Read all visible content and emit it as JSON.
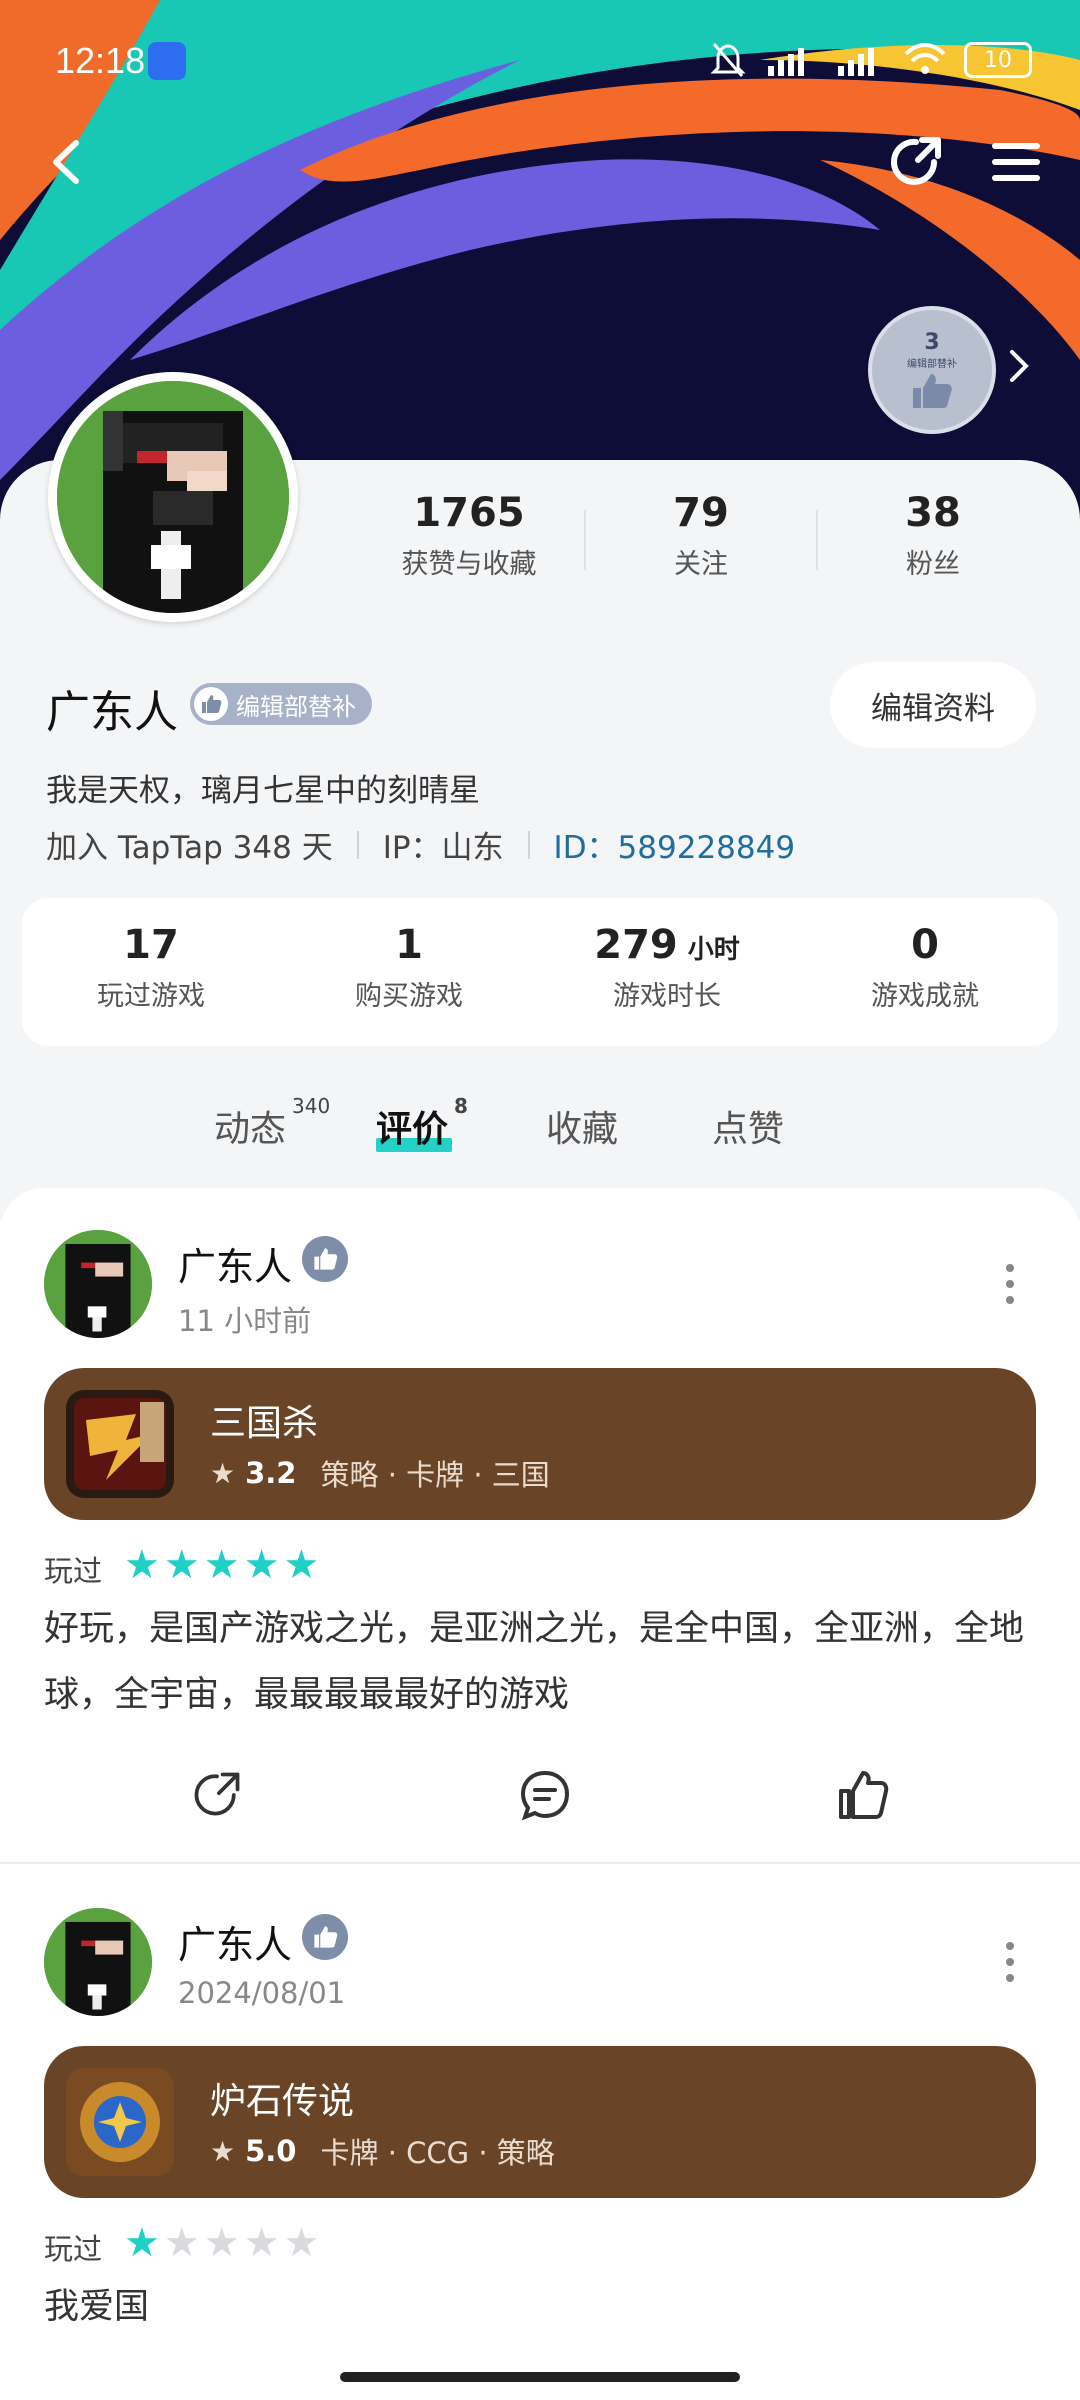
{
  "status_bar": {
    "time": "12:18",
    "battery": "10"
  },
  "header": {
    "badge_level": "3",
    "badge_caption": "编辑部替补"
  },
  "profile": {
    "stats": [
      {
        "value": "1765",
        "label": "获赞与收藏"
      },
      {
        "value": "79",
        "label": "关注"
      },
      {
        "value": "38",
        "label": "粉丝"
      }
    ],
    "username": "广东人",
    "badge": "编辑部替补",
    "edit_button": "编辑资料",
    "bio": "我是天权，璃月七星中的刻晴星",
    "joined": "加入 TapTap 348 天",
    "ip": "IP：山东",
    "id": "ID：589228849"
  },
  "game_stats": [
    {
      "value": "17",
      "unit": "",
      "label": "玩过游戏"
    },
    {
      "value": "1",
      "unit": "",
      "label": "购买游戏"
    },
    {
      "value": "279",
      "unit": "小时",
      "label": "游戏时长"
    },
    {
      "value": "0",
      "unit": "",
      "label": "游戏成就"
    }
  ],
  "tabs": [
    {
      "label": "动态",
      "count": "340"
    },
    {
      "label": "评价",
      "count": "8"
    },
    {
      "label": "收藏",
      "count": ""
    },
    {
      "label": "点赞",
      "count": ""
    }
  ],
  "posts": [
    {
      "author": "广东人",
      "time": "11 小时前",
      "game": {
        "title": "三国杀",
        "rating": "3.2",
        "tags": "策略 · 卡牌 · 三国"
      },
      "played_label": "玩过",
      "stars": 5,
      "text": "好玩，是国产游戏之光，是亚洲之光，是全中国，全亚洲，全地球，全宇宙，最最最最最好的游戏"
    },
    {
      "author": "广东人",
      "time": "2024/08/01",
      "game": {
        "title": "炉石传说",
        "rating": "5.0",
        "tags": "卡牌 · CCG · 策略"
      },
      "played_label": "玩过",
      "stars": 1,
      "text": "我爱国"
    }
  ],
  "colors": {
    "accent": "#25d0c6",
    "card_brown": "#6a4426",
    "id_blue": "#1f6e9c"
  }
}
